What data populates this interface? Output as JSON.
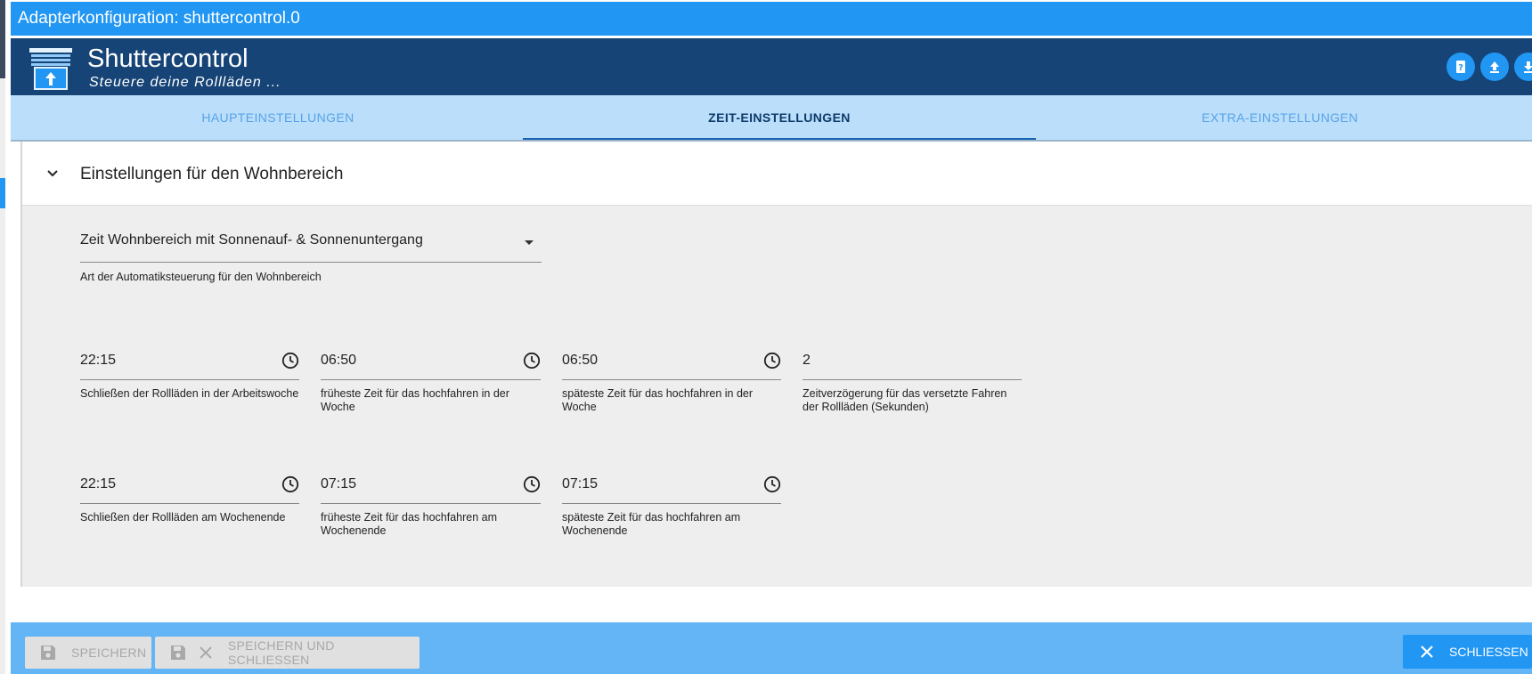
{
  "window": {
    "title": "Adapterkonfiguration: shuttercontrol.0"
  },
  "app": {
    "title": "Shuttercontrol",
    "subtitle": "Steuere deine Rollläden ..."
  },
  "header_buttons": [
    {
      "icon": "help-book-icon"
    },
    {
      "icon": "upload-icon"
    },
    {
      "icon": "download-icon"
    }
  ],
  "tabs": [
    {
      "label": "HAUPTEINSTELLUNGEN",
      "active": false
    },
    {
      "label": "ZEIT-EINSTELLUNGEN",
      "active": true
    },
    {
      "label": "EXTRA-EINSTELLUNGEN",
      "active": false
    }
  ],
  "section": {
    "title": "Einstellungen für den Wohnbereich",
    "expanded": true,
    "mode_select": {
      "value": "Zeit Wohnbereich mit Sonnenauf- & Sonnenuntergang",
      "helper": "Art der Automatiksteuerung für den Wohnbereich"
    },
    "row1": [
      {
        "value": "22:15",
        "helper": "Schließen der Rollläden in der Arbeitswoche",
        "icon": "clock-icon"
      },
      {
        "value": "06:50",
        "helper": "früheste Zeit für das hochfahren in der Woche",
        "icon": "clock-icon"
      },
      {
        "value": "06:50",
        "helper": "späteste Zeit für das hochfahren in der Woche",
        "icon": "clock-icon"
      },
      {
        "value": "2",
        "helper": "Zeitverzögerung für das versetzte Fahren der Rollläden (Sekunden)"
      }
    ],
    "row2": [
      {
        "value": "22:15",
        "helper": "Schließen der Rollläden am Wochenende",
        "icon": "clock-icon"
      },
      {
        "value": "07:15",
        "helper": "früheste Zeit für das hochfahren am Wochenende",
        "icon": "clock-icon"
      },
      {
        "value": "07:15",
        "helper": "späteste Zeit für das hochfahren am Wochenende",
        "icon": "clock-icon"
      }
    ]
  },
  "footer": {
    "save_label": "SPEICHERN",
    "save_close_label": "SPEICHERN UND SCHLIESSEN",
    "close_label": "SCHLIESSEN"
  },
  "colors": {
    "title_bar": "#2196f3",
    "app_header": "#164477",
    "tab_bar": "#bbdefb",
    "footer": "#64b5f6"
  }
}
